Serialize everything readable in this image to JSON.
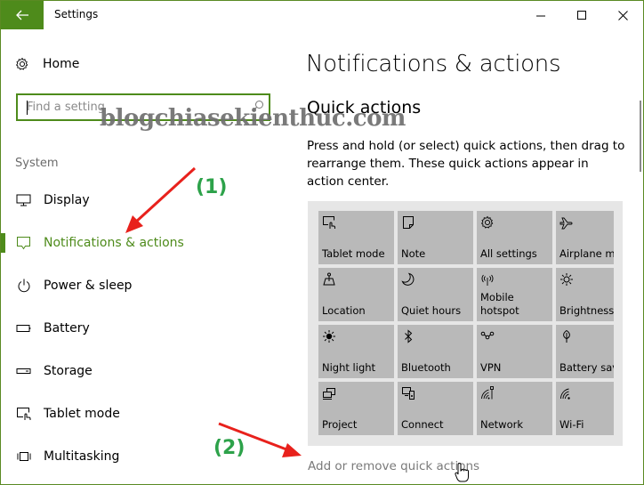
{
  "window": {
    "title": "Settings",
    "back_icon": "back-arrow-icon",
    "controls": [
      "minimize",
      "maximize",
      "close"
    ],
    "accent_color": "#4e8b1b"
  },
  "sidebar": {
    "home_label": "Home",
    "search": {
      "placeholder": "Find a setting",
      "value": ""
    },
    "section_label": "System",
    "items": [
      {
        "label": "Display",
        "icon": "monitor-icon",
        "active": false
      },
      {
        "label": "Notifications & actions",
        "icon": "notification-icon",
        "active": true
      },
      {
        "label": "Power & sleep",
        "icon": "power-icon",
        "active": false
      },
      {
        "label": "Battery",
        "icon": "battery-icon",
        "active": false
      },
      {
        "label": "Storage",
        "icon": "storage-icon",
        "active": false
      },
      {
        "label": "Tablet mode",
        "icon": "tablet-mode-icon",
        "active": false
      },
      {
        "label": "Multitasking",
        "icon": "multitasking-icon",
        "active": false
      }
    ]
  },
  "main": {
    "page_title": "Notifications & actions",
    "section_title": "Quick actions",
    "description": "Press and hold (or select) quick actions, then drag to rearrange them. These quick actions appear in action center.",
    "tiles": [
      {
        "label": "Tablet mode",
        "icon": "tablet-mode-icon"
      },
      {
        "label": "Note",
        "icon": "note-icon"
      },
      {
        "label": "All settings",
        "icon": "gear-icon"
      },
      {
        "label": "Airplane mode",
        "icon": "airplane-icon"
      },
      {
        "label": "Location",
        "icon": "location-icon"
      },
      {
        "label": "Quiet hours",
        "icon": "moon-icon"
      },
      {
        "label": "Mobile hotspot",
        "icon": "hotspot-icon"
      },
      {
        "label": "Brightness",
        "icon": "brightness-icon"
      },
      {
        "label": "Night light",
        "icon": "night-light-icon"
      },
      {
        "label": "Bluetooth",
        "icon": "bluetooth-icon"
      },
      {
        "label": "VPN",
        "icon": "vpn-icon"
      },
      {
        "label": "Battery saver",
        "icon": "battery-saver-icon"
      },
      {
        "label": "Project",
        "icon": "project-icon"
      },
      {
        "label": "Connect",
        "icon": "connect-icon"
      },
      {
        "label": "Network",
        "icon": "network-icon"
      },
      {
        "label": "Wi-Fi",
        "icon": "wifi-icon"
      }
    ],
    "add_remove_link": "Add or remove quick actions"
  },
  "overlay": {
    "watermark": "blogchiasekienthuc.com",
    "annotation_1": "(1)",
    "annotation_2": "(2)",
    "arrow_color": "#e8211c",
    "annotation_color": "#2da24a"
  }
}
